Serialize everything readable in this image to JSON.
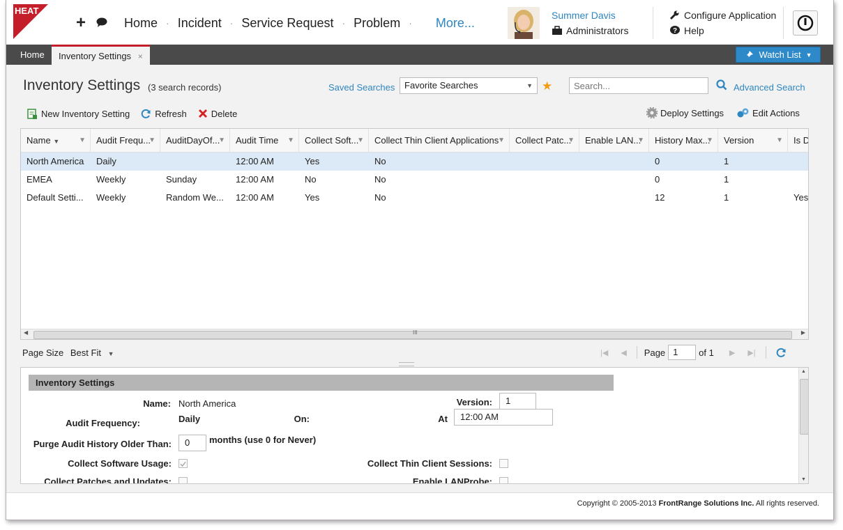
{
  "app": {
    "logo_text": "HEAT",
    "nav": [
      "Home",
      "Incident",
      "Service Request",
      "Problem"
    ],
    "more": "More...",
    "user_name": "Summer Davis",
    "user_role": "Administrators",
    "configure": "Configure Application",
    "help": "Help",
    "brand_color": "#c41e2a",
    "accent_color": "#2e86c1"
  },
  "tabs": {
    "home": "Home",
    "active": "Inventory Settings",
    "close_glyph": "×",
    "watch_list": "Watch List"
  },
  "page": {
    "title": "Inventory Settings",
    "records": "(3 search records)",
    "saved_searches": "Saved Searches",
    "favorite_searches": "Favorite Searches",
    "search_placeholder": "Search...",
    "advanced_search": "Advanced Search"
  },
  "toolbar": {
    "new_label": "New Inventory Setting",
    "refresh_label": "Refresh",
    "delete_label": "Delete",
    "deploy_label": "Deploy Settings",
    "edit_actions_label": "Edit Actions"
  },
  "grid": {
    "columns": [
      "Name",
      "Audit Frequ...",
      "AuditDayOf...",
      "Audit Time",
      "Collect Soft...",
      "Collect Thin Client Applications",
      "Collect Patc...",
      "Enable LAN...",
      "History Max...",
      "Version",
      "Is D"
    ],
    "rows": [
      [
        "North America",
        "Daily",
        "",
        "12:00 AM",
        "Yes",
        "No",
        "",
        "",
        "0",
        "1",
        ""
      ],
      [
        "EMEA",
        "Weekly",
        "Sunday",
        "12:00 AM",
        "No",
        "No",
        "",
        "",
        "0",
        "1",
        ""
      ],
      [
        "Default Setti...",
        "Weekly",
        "Random We...",
        "12:00 AM",
        "Yes",
        "No",
        "",
        "",
        "12",
        "1",
        "Yes"
      ]
    ],
    "scroll_grip": "III"
  },
  "pager": {
    "page_size_label": "Page Size",
    "page_size_value": "Best Fit",
    "page_label": "Page",
    "page_value": "1",
    "of_label": "of 1"
  },
  "detail": {
    "section_title": "Inventory Settings",
    "name_label": "Name:",
    "name_value": "North America",
    "version_label": "Version:",
    "version_value": "1",
    "audit_freq_label": "Audit Frequency:",
    "audit_freq_value": "Daily",
    "on_label": "On:",
    "at_label": "At",
    "at_value": "12:00 AM",
    "purge_label": "Purge Audit History Older Than:",
    "purge_value": "0",
    "purge_suffix": "months (use 0 for Never)",
    "collect_sw_label": "Collect Software Usage:",
    "collect_sw_checked": true,
    "collect_thin_label": "Collect Thin Client Sessions:",
    "collect_thin_checked": false,
    "collect_patches_label": "Collect Patches and Updates:",
    "collect_patches_checked": false,
    "enable_lan_label": "Enable LANProbe:",
    "enable_lan_checked": false
  },
  "footer": {
    "copyright_prefix": "Copyright © 2005-2013 ",
    "company": "FrontRange Solutions Inc.",
    "suffix": " All rights reserved."
  }
}
